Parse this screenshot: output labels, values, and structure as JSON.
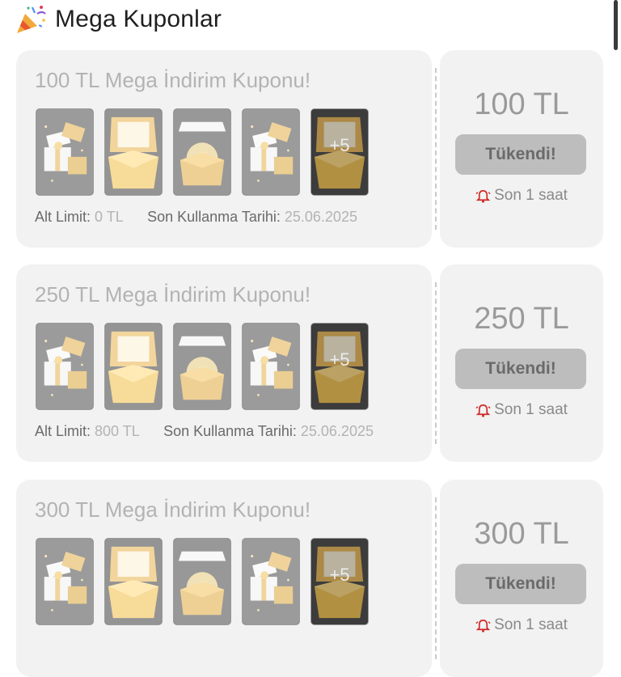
{
  "header": {
    "title": "Mega Kuponlar",
    "icon": "party-popper-icon"
  },
  "coupons": [
    {
      "title": "100 TL Mega İndirim Kuponu!",
      "more_badge": "+5",
      "alt_limit_label": "Alt Limit:",
      "alt_limit_value": "0 TL",
      "expiry_label": "Son Kullanma Tarihi:",
      "expiry_value": "25.06.2025",
      "amount": "100 TL",
      "button_label": "Tükendi!",
      "timer": "Son 1 saat"
    },
    {
      "title": "250 TL Mega İndirim Kuponu!",
      "more_badge": "+5",
      "alt_limit_label": "Alt Limit:",
      "alt_limit_value": "800 TL",
      "expiry_label": "Son Kullanma Tarihi:",
      "expiry_value": "25.06.2025",
      "amount": "250 TL",
      "button_label": "Tükendi!",
      "timer": "Son 1 saat"
    },
    {
      "title": "300 TL Mega İndirim Kuponu!",
      "more_badge": "+5",
      "amount": "300 TL",
      "button_label": "Tükendi!",
      "timer": "Son 1 saat"
    }
  ],
  "colors": {
    "card_bg": "#f2f2f2",
    "button_bg": "#bdbdbd",
    "alarm_red": "#d22b2b",
    "gold": "#d9a73a"
  }
}
